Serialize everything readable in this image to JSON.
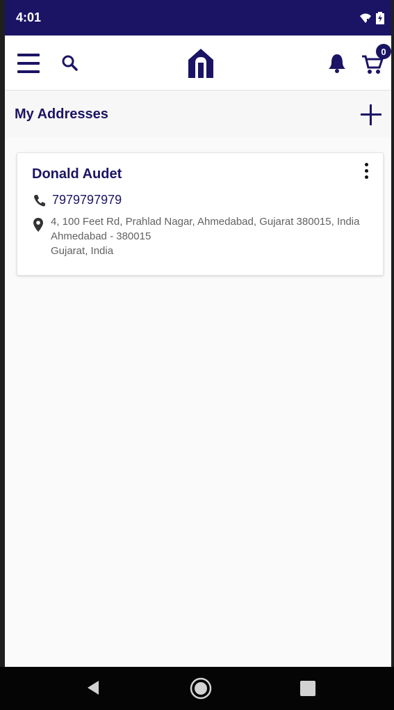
{
  "status_bar": {
    "time": "4:01",
    "icons": [
      "wifi-icon",
      "battery-charging-icon"
    ]
  },
  "app_bar": {
    "menu_icon": "menu-icon",
    "search_icon": "search-icon",
    "logo_icon": "house-logo-icon",
    "notification_icon": "bell-icon",
    "cart_icon": "cart-icon",
    "cart_count": "0"
  },
  "page": {
    "title": "My Addresses",
    "add_icon": "plus-icon"
  },
  "address_card": {
    "name": "Donald Audet",
    "phone": "7979797979",
    "address_line1": "4, 100 Feet Rd, Prahlad Nagar, Ahmedabad, Gujarat 380015, India",
    "address_line2": "Ahmedabad - 380015",
    "address_line3": "Gujarat, India",
    "phone_icon": "phone-icon",
    "location_icon": "location-pin-icon",
    "more_icon": "more-vertical-icon"
  },
  "nav_bar": {
    "back_icon": "back-icon",
    "home_icon": "home-icon",
    "recent_icon": "recent-apps-icon"
  },
  "colors": {
    "primary": "#1b1464",
    "background": "#f7f7f7"
  }
}
